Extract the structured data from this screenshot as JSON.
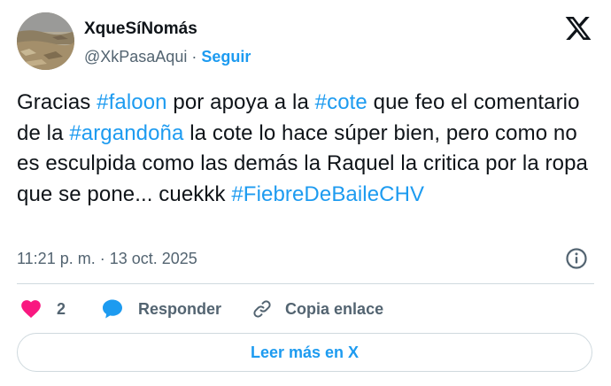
{
  "author": {
    "name": "XqueSíNomás",
    "handle": "@XkPasaAqui",
    "separator": "·",
    "follow_label": "Seguir"
  },
  "tweet": {
    "segments": [
      {
        "text": "Gracias ",
        "hashtag": false
      },
      {
        "text": "#faloon",
        "hashtag": true
      },
      {
        "text": " por apoya a la ",
        "hashtag": false
      },
      {
        "text": "#cote",
        "hashtag": true
      },
      {
        "text": " que feo el comentario de la ",
        "hashtag": false
      },
      {
        "text": "#argandoña",
        "hashtag": true
      },
      {
        "text": " la cote lo hace súper bien, pero como no es esculpida como las demás la Raquel la critica por la ropa que se pone... cuekkk ",
        "hashtag": false
      },
      {
        "text": "#FiebreDeBaileCHV",
        "hashtag": true
      }
    ],
    "timestamp": "11:21 p. m. · 13 oct. 2025"
  },
  "actions": {
    "like_count": "2",
    "reply_label": "Responder",
    "copy_label": "Copia enlace"
  },
  "read_more_label": "Leer más en X",
  "colors": {
    "accent": "#1d9bf0",
    "text": "#0f1419",
    "secondary": "#536471",
    "like": "#f91880",
    "border": "#cfd9de"
  },
  "icons": {
    "brand": "x-logo-icon",
    "info": "info-icon",
    "like": "heart-icon",
    "reply": "speech-bubble-icon",
    "copy": "link-icon"
  }
}
